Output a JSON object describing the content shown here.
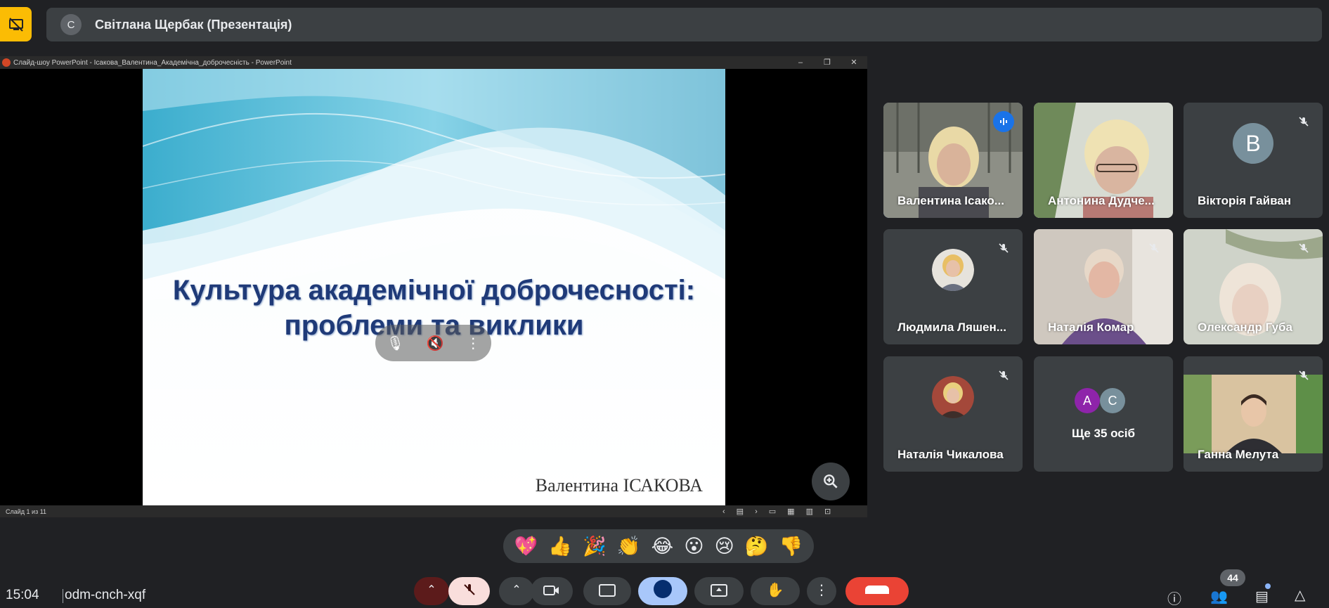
{
  "presenter": {
    "avatar_letter": "С",
    "name": "Світлана Щербак (Презентація)"
  },
  "ppt": {
    "title": "Слайд-шоу PowerPoint  -  Ісакова_Валентина_Академічна_доброчесність  -  PowerPoint",
    "status": "Слайд 1 из 11",
    "slide_title_line1": "Культура академічної доброчесності:",
    "slide_title_line2": "проблеми та виклики",
    "slide_author": "Валентина ІСАКОВА"
  },
  "participants": [
    {
      "name": "Валентина Ісако...",
      "type": "video",
      "speaking": true
    },
    {
      "name": "Антонина Дудче...",
      "type": "video",
      "muted": false
    },
    {
      "name": "Вікторія Гайван",
      "type": "letter",
      "letter": "В",
      "color": "#78909c",
      "muted": true
    },
    {
      "name": "Людмила Ляшен...",
      "type": "photo",
      "muted": true
    },
    {
      "name": "Наталія Комар",
      "type": "video",
      "muted": true
    },
    {
      "name": "Олександр Губа",
      "type": "video",
      "muted": true
    },
    {
      "name": "Наталія Чикалова",
      "type": "photo",
      "muted": true
    },
    {
      "name": "Ще 35 осіб",
      "type": "more",
      "letters": [
        "А",
        "С"
      ]
    },
    {
      "name": "Ганна Мелута",
      "type": "video",
      "muted": true
    }
  ],
  "reactions": [
    "💖",
    "👍",
    "🎉",
    "👏",
    "😂",
    "😮",
    "😢",
    "🤔",
    "👎"
  ],
  "bottom": {
    "time": "15:04",
    "meeting_code": "odm-cnch-xqf",
    "people_count": "44"
  },
  "colors": {
    "background": "#202124",
    "tile": "#3c4043",
    "accent": "#8ab4f8",
    "present_badge": "#fbbc04",
    "end_call": "#ea4335"
  }
}
